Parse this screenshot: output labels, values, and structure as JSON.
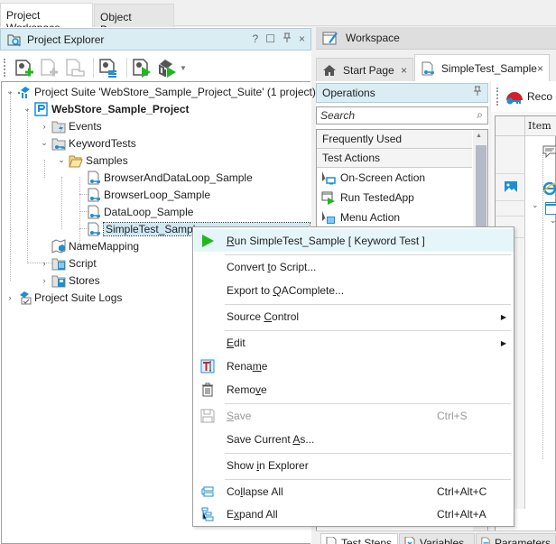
{
  "top_tabs": [
    {
      "label": "Project Workspace",
      "active": true
    },
    {
      "label": "Object Browser",
      "active": false
    }
  ],
  "project_explorer": {
    "title": "Project Explorer",
    "header_controls": {
      "help": "?",
      "maximize": "☐",
      "pin": "📌",
      "close": "×"
    },
    "toolbar": [
      {
        "name": "add-new-project-item",
        "icon": "new-item-icon"
      },
      {
        "name": "add-new-item",
        "icon": "add-file-icon",
        "disabled": true
      },
      {
        "name": "add-existing-item",
        "icon": "open-file-icon",
        "disabled": true
      },
      {
        "name": "project-properties",
        "icon": "properties-icon"
      },
      {
        "name": "run-project",
        "icon": "run-project-icon"
      },
      {
        "name": "run-suite",
        "icon": "run-suite-icon"
      }
    ],
    "tree": [
      {
        "label": "Project Suite 'WebStore_Sample_Project_Suite' (1 project)",
        "level": 0,
        "expanded": true,
        "icon": "project-suite-icon"
      },
      {
        "label": "WebStore_Sample_Project",
        "level": 1,
        "expanded": true,
        "bold": true,
        "icon": "project-icon"
      },
      {
        "label": "Events",
        "level": 2,
        "expanded": false,
        "icon": "events-folder-icon"
      },
      {
        "label": "KeywordTests",
        "level": 2,
        "expanded": true,
        "icon": "keyword-tests-folder-icon"
      },
      {
        "label": "Samples",
        "level": 3,
        "expanded": true,
        "icon": "open-folder-icon"
      },
      {
        "label": "BrowserAndDataLoop_Sample",
        "level": 4,
        "icon": "keyword-test-icon"
      },
      {
        "label": "BrowserLoop_Sample",
        "level": 4,
        "icon": "keyword-test-icon"
      },
      {
        "label": "DataLoop_Sample",
        "level": 4,
        "icon": "keyword-test-icon"
      },
      {
        "label": "SimpleTest_Sample",
        "level": 4,
        "icon": "keyword-test-icon",
        "selected": true
      },
      {
        "label": "NameMapping",
        "level": 2,
        "icon": "name-mapping-icon"
      },
      {
        "label": "Script",
        "level": 2,
        "expanded": false,
        "icon": "script-folder-icon"
      },
      {
        "label": "Stores",
        "level": 2,
        "expanded": false,
        "icon": "stores-folder-icon"
      },
      {
        "label": "Project Suite Logs",
        "level": 0,
        "expanded": false,
        "icon": "logs-icon"
      }
    ]
  },
  "workspace": {
    "title": "Workspace",
    "tabs": [
      {
        "label": "Start Page",
        "close": "×"
      },
      {
        "label": "SimpleTest_Sample",
        "close": "×",
        "active": true
      }
    ],
    "operations": {
      "title": "Operations",
      "search_placeholder": "Search",
      "categories": [
        "Frequently Used",
        "Test Actions"
      ],
      "items": [
        "On-Screen Action",
        "Run TestedApp",
        "Menu Action"
      ]
    },
    "editor": {
      "record_label": "Reco",
      "grid_header": "Item"
    },
    "bottom_tabs": [
      "Test Steps",
      "Variables",
      "Parameters"
    ]
  },
  "context_menu": {
    "items": [
      {
        "pre": "",
        "ul": "R",
        "post": "un SimpleTest_Sample  [ Keyword Test ]",
        "icon": "run-icon",
        "hover": true
      },
      {
        "pre": "Convert ",
        "ul": "t",
        "post": "o Script...",
        "sep_before": true
      },
      {
        "pre": "Export to ",
        "ul": "Q",
        "post": "AComplete..."
      },
      {
        "pre": "Source ",
        "ul": "C",
        "post": "ontrol",
        "submenu": true,
        "sep_before": true
      },
      {
        "pre": "",
        "ul": "E",
        "post": "dit",
        "submenu": true,
        "sep_before": true
      },
      {
        "pre": "Rena",
        "ul": "m",
        "post": "e",
        "icon": "rename-icon"
      },
      {
        "pre": "Remo",
        "ul": "v",
        "post": "e",
        "icon": "trash-icon"
      },
      {
        "pre": "",
        "ul": "S",
        "post": "ave",
        "shortcut": "Ctrl+S",
        "icon": "save-icon",
        "disabled": true,
        "sep_before": true
      },
      {
        "pre": "Save Current ",
        "ul": "A",
        "post": "s..."
      },
      {
        "pre": "Show ",
        "ul": "i",
        "post": "n Explorer",
        "sep_before": true
      },
      {
        "pre": "Co",
        "ul": "l",
        "post": "lapse All",
        "shortcut": "Ctrl+Alt+C",
        "icon": "collapse-all-icon",
        "sep_before": true
      },
      {
        "pre": "E",
        "ul": "x",
        "post": "pand All",
        "shortcut": "Ctrl+Alt+A",
        "icon": "expand-all-icon"
      }
    ]
  },
  "colors": {
    "panel_header_bg": "#d9edf3",
    "selection_bg": "#cfe9f3",
    "menu_hover_bg": "#e5f6fb",
    "run_green": "#1fb81f",
    "accent_blue": "#1a8fd6"
  }
}
